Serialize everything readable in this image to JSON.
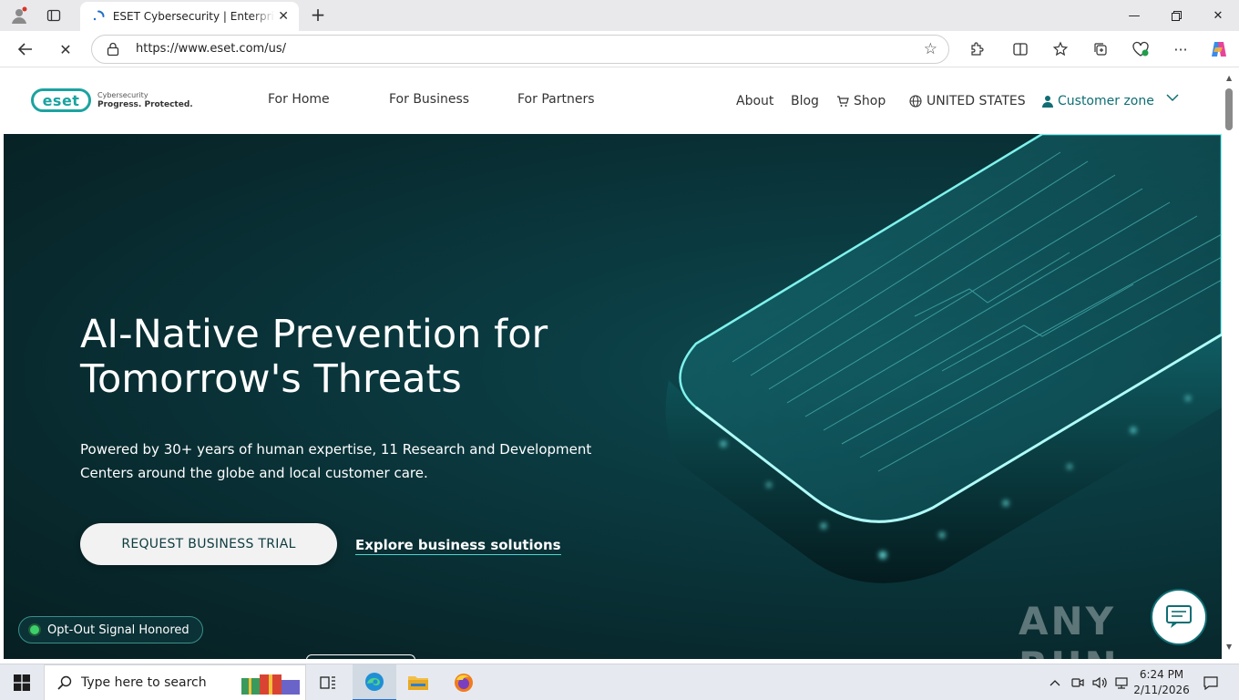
{
  "browser": {
    "tab_title": "ESET Cybersecurity | Enterprise, Business and Home Solutions",
    "url": "https://www.eset.com/us/"
  },
  "site": {
    "logo_text": "eset",
    "logo_tagline_1": "Cybersecurity",
    "logo_tagline_2": "Progress. Protected.",
    "nav": [
      "For Home",
      "For Business",
      "For Partners"
    ],
    "secondary_nav": {
      "about": "About",
      "blog": "Blog",
      "shop": "Shop",
      "region": "UNITED STATES",
      "customer_zone": "Customer zone"
    },
    "hero": {
      "title_line1": "AI-Native Prevention for",
      "title_line2": "Tomorrow's Threats",
      "subtitle_line1": "Powered by 30+ years of human expertise, 11 Research and Development",
      "subtitle_line2": "Centers around the globe and local customer care.",
      "primary_button": "REQUEST BUSINESS TRIAL",
      "secondary_link": "Explore business solutions"
    },
    "optout_label": "Opt-Out Signal Honored",
    "watermark": "ANY RUN"
  },
  "taskbar": {
    "search_placeholder": "Type here to search",
    "time": "6:24 PM",
    "date": "2/11/2026"
  },
  "colors": {
    "brand_teal": "#1ba3a0",
    "hero_bg": "#08282c",
    "link_teal": "#0f6e73"
  }
}
